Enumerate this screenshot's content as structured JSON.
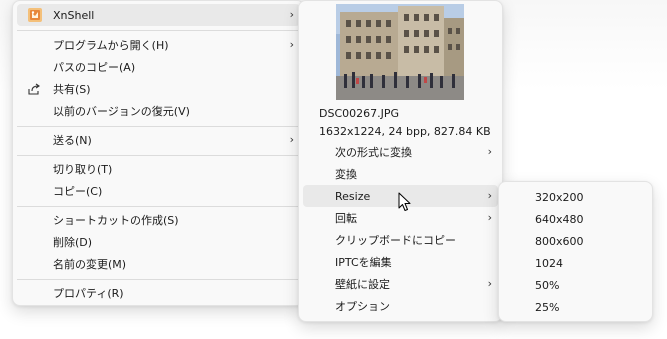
{
  "main_menu": {
    "xnshell": "XnShell",
    "open_with": "プログラムから開く(H)",
    "copy_path": "パスのコピー(A)",
    "share": "共有(S)",
    "restore_previous": "以前のバージョンの復元(V)",
    "send_to": "送る(N)",
    "cut": "切り取り(T)",
    "copy": "コピー(C)",
    "create_shortcut": "ショートカットの作成(S)",
    "delete": "削除(D)",
    "rename": "名前の変更(M)",
    "properties": "プロパティ(R)"
  },
  "xnshell_menu": {
    "filename": "DSC00267.JPG",
    "info": "1632x1224, 24 bpp, 827.84 KB",
    "convert_to": "次の形式に変換",
    "convert": "変換",
    "resize": "Resize",
    "rotate": "回転",
    "copy_clipboard": "クリップボードにコピー",
    "iptc_edit": "IPTCを編集",
    "set_wallpaper": "壁紙に設定",
    "options": "オプション"
  },
  "resize_menu": {
    "items": [
      "320x200",
      "640x480",
      "800x600",
      "1024",
      "50%",
      "25%"
    ]
  },
  "arrow_glyph": "›",
  "icons": {
    "xnshell": "xnshell-icon",
    "share": "share-icon",
    "preview": "photo-preview",
    "cursor": "mouse-cursor-icon"
  },
  "colors": {
    "menu_bg": "#f9f9f9",
    "hover_bg": "#e9e9e9",
    "separator": "#dcdcdc",
    "xnshell_icon": "#e8873a"
  }
}
